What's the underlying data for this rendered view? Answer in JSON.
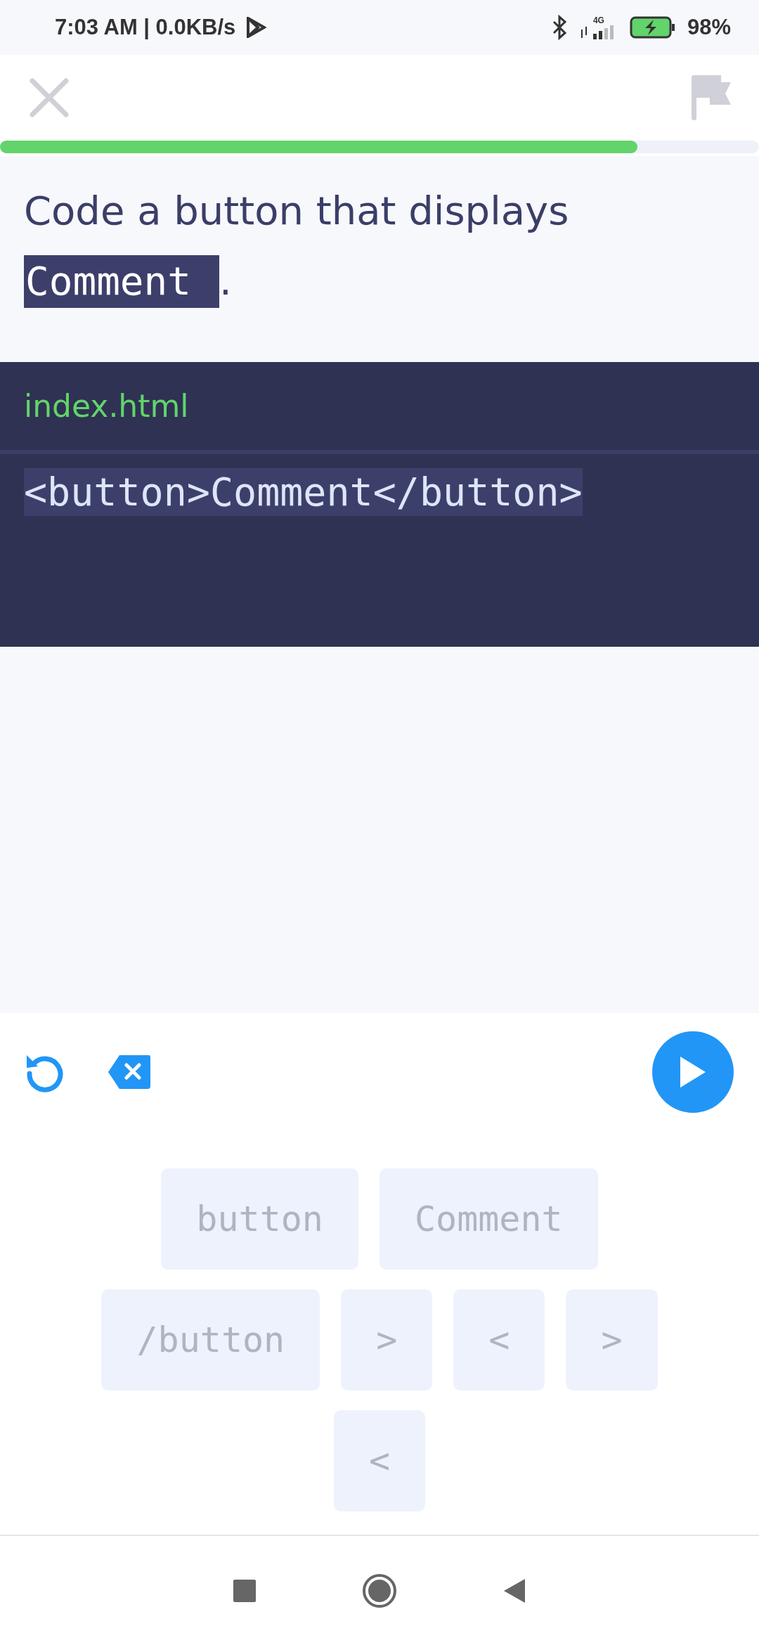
{
  "status_bar": {
    "time": "7:03 AM | 0.0KB/s",
    "network": "4G",
    "battery": "98%"
  },
  "progress": {
    "level": 0.84
  },
  "prompt": {
    "text": "Code a button that displays",
    "highlight": "Comment",
    "suffix": "."
  },
  "editor": {
    "filename": "index.html",
    "code": "<button>Comment</button>"
  },
  "tiles": [
    [
      {
        "label": "button",
        "used": true
      },
      {
        "label": "Comment",
        "used": true
      }
    ],
    [
      {
        "label": "/button",
        "used": true
      },
      {
        "label": ">",
        "used": true
      },
      {
        "label": "<",
        "used": true
      },
      {
        "label": ">",
        "used": true
      }
    ],
    [
      {
        "label": "<",
        "used": true
      }
    ]
  ]
}
